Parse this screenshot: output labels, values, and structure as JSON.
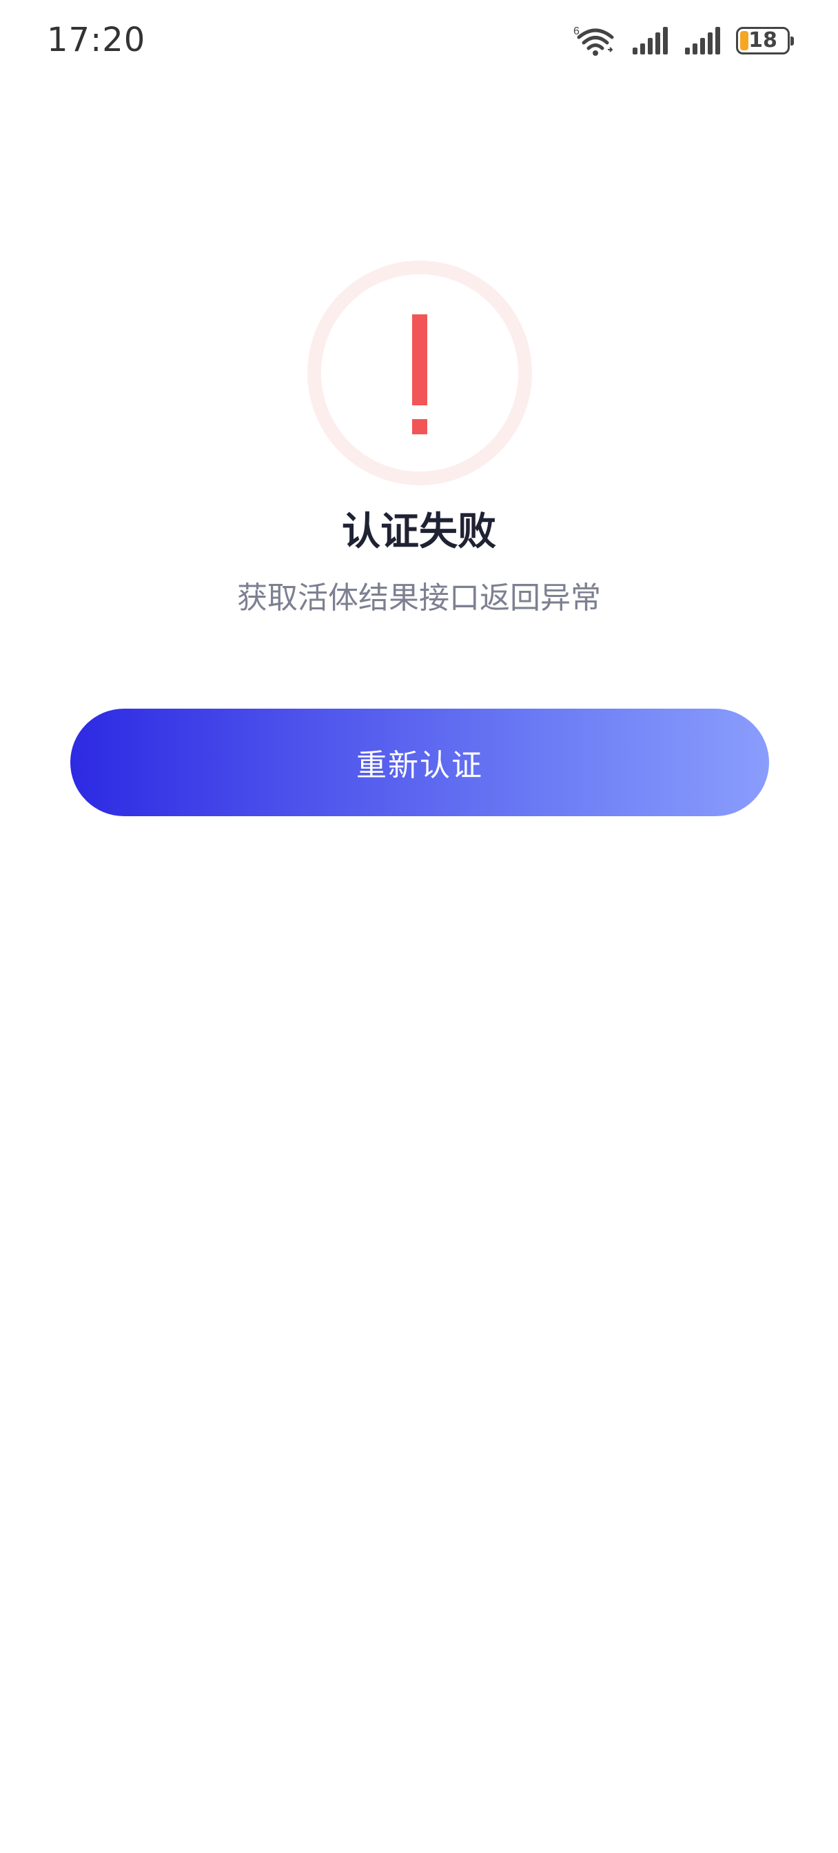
{
  "status_bar": {
    "time": "17:20",
    "battery_level": "18",
    "icons": [
      "wifi-6-icon",
      "signal-icon",
      "signal-icon",
      "battery-icon"
    ],
    "battery_color": "#f5a623"
  },
  "result": {
    "icon": "exclamation-icon",
    "title": "认证失败",
    "message": "获取活体结果接口返回异常",
    "accent_color": "#f25555"
  },
  "actions": {
    "retry_label": "重新认证",
    "gradient": [
      "#2d2ae3",
      "#8a9dfc"
    ]
  }
}
